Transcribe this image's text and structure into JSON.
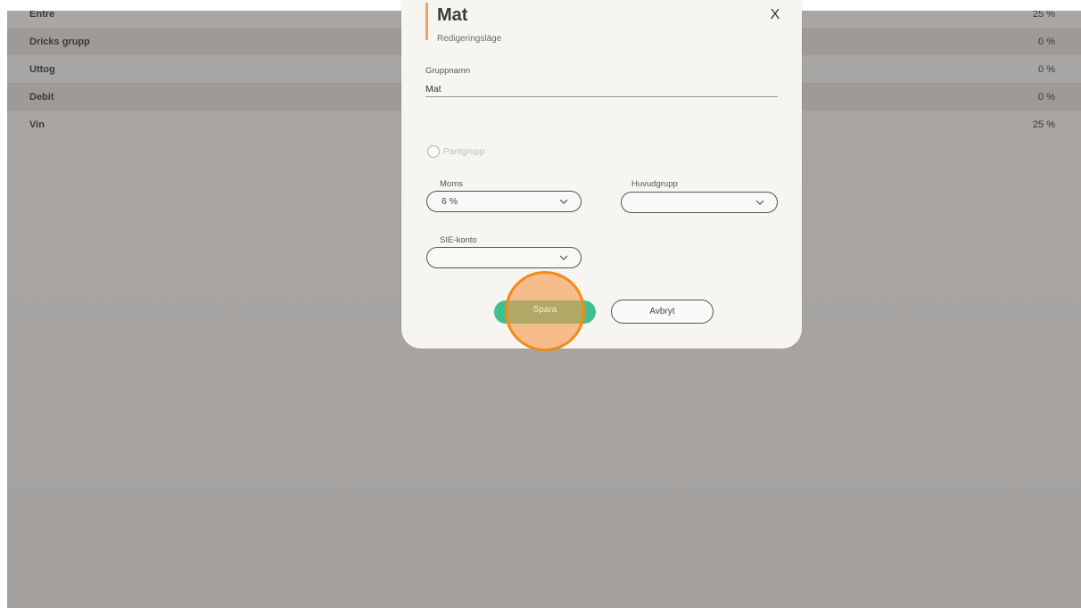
{
  "groups": [
    {
      "name": "Entre",
      "vat": "25 %"
    },
    {
      "name": "Dricks grupp",
      "vat": "0 %"
    },
    {
      "name": "Uttog",
      "vat": "0 %"
    },
    {
      "name": "Debit",
      "vat": "0 %"
    },
    {
      "name": "Vin",
      "vat": "25 %"
    }
  ],
  "modal": {
    "title": "Mat",
    "subtitle": "Redigeringsläge",
    "close_glyph": "X",
    "group_name_label": "Gruppnamn",
    "group_name_value": "Mat",
    "radio_label": "Pantgrupp",
    "vat_label": "Moms",
    "vat_value": "6 %",
    "main_group_label": "Huvudgrupp",
    "main_group_value": "",
    "sie_label": "SIE-konto",
    "sie_value": "",
    "save_label": "Spara",
    "cancel_label": "Avbryt"
  },
  "colors": {
    "accent": "#f0a463",
    "save_button": "#3ec08f",
    "click_highlight": "#f08a1a"
  }
}
